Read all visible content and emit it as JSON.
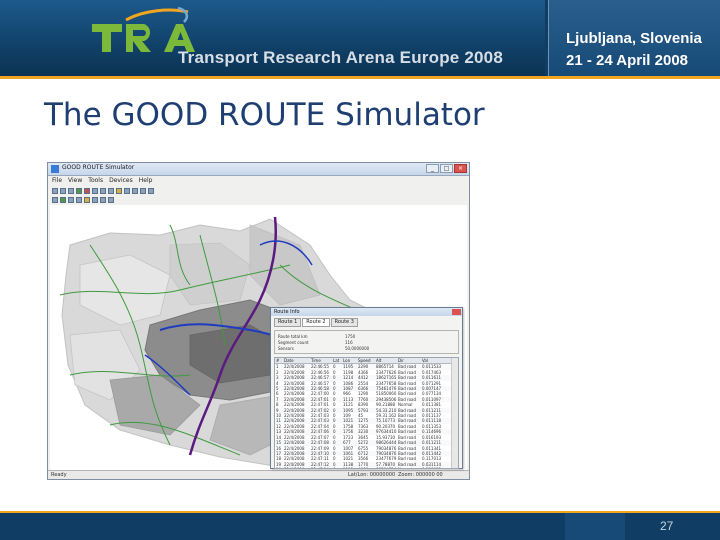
{
  "banner": {
    "logo_text": "TRA",
    "subtitle": "Transport Research Arena Europe 2008",
    "city": "Ljubljana, Slovenia",
    "dates": "21 - 24 April 2008",
    "colors": {
      "background": "#0f3d63",
      "accent": "#f2a51f",
      "logo_green": "#7cb83a"
    }
  },
  "slide": {
    "title": "The GOOD ROUTE Simulator",
    "page_number": "27"
  },
  "app_window": {
    "title": "GOOD ROUTE Simulator",
    "menu": [
      "File",
      "View",
      "Tools",
      "Devices",
      "Help"
    ],
    "window_buttons": [
      "minimize-icon",
      "maximize-icon",
      "close-icon"
    ],
    "status": {
      "left": "Ready",
      "middle": "Lat/Lon: 00000000",
      "right": "Zoom: 000000 00"
    }
  },
  "route_dialog": {
    "title": "Route Info",
    "tabs": [
      "Route 1",
      "Route 2",
      "Route 3"
    ],
    "info": [
      {
        "key": "Route total km",
        "value": "1750"
      },
      {
        "key": "Segment count",
        "value": "116"
      },
      {
        "key": "Sensors",
        "value": "50,0000000"
      }
    ],
    "columns": [
      "#",
      "Date",
      "Time",
      "Lat",
      "Lon",
      "Speed",
      "Alt",
      "Dir",
      "Val"
    ],
    "rows": [
      [
        "1",
        "22/4/2008",
        "22:46:55",
        "0",
        "1195",
        "2290",
        "8865714",
        "Bad road",
        "0.011533"
      ],
      [
        "2",
        "22/4/2008",
        "22:46:56",
        "0",
        "1198",
        "4366",
        "23477626",
        "Bad road",
        "0.017463"
      ],
      [
        "3",
        "22/4/2008",
        "22:46:57",
        "0",
        "1214",
        "4412",
        "18627165",
        "Bad road",
        "0.011611"
      ],
      [
        "4",
        "22/4/2008",
        "22:46:57",
        "0",
        "1086",
        "2554",
        "23477658",
        "Bad road",
        "0.071291"
      ],
      [
        "5",
        "22/4/2008",
        "22:46:58",
        "0",
        "1087",
        "6366",
        "75461476",
        "Bad road",
        "0.007147"
      ],
      [
        "6",
        "22/4/2008",
        "22:47:00",
        "0",
        "966",
        "1290",
        "51850060",
        "Bad road",
        "0.077134"
      ],
      [
        "7",
        "22/4/2008",
        "22:47:01",
        "0",
        "1113",
        "7760",
        "29438506",
        "Bad road",
        "0.011097"
      ],
      [
        "8",
        "22/4/2008",
        "22:47:01",
        "0",
        "1121",
        "8390",
        "90.21888",
        "Normal",
        "0.011381"
      ],
      [
        "9",
        "22/4/2008",
        "22:47:02",
        "0",
        "1095",
        "5793",
        "54.33.210",
        "Bad road",
        "0.011211"
      ],
      [
        "10",
        "22/4/2008",
        "22:47:03",
        "0",
        "109",
        "45",
        "59.31.162",
        "Bad road",
        "0.011137"
      ],
      [
        "11",
        "22/4/2008",
        "22:47:03",
        "0",
        "1021",
        "1275",
        "75.10773",
        "Bad road",
        "0.011118"
      ],
      [
        "12",
        "22/4/2008",
        "22:47:04",
        "0",
        "1758",
        "7363",
        "90.20370",
        "Bad road",
        "0.011353"
      ],
      [
        "13",
        "22/4/2008",
        "22:47:06",
        "0",
        "1756",
        "3230",
        "97634410",
        "Bad road",
        "0.114696"
      ],
      [
        "14",
        "22/4/2008",
        "22:47:07",
        "0",
        "1723",
        "3645",
        "15.93730",
        "Bad road",
        "0.016193"
      ],
      [
        "15",
        "22/4/2008",
        "22:47:08",
        "0",
        "677",
        "5272",
        "98626444",
        "Bad road",
        "0.011211"
      ],
      [
        "16",
        "22/4/2008",
        "22:47:09",
        "0",
        "1007",
        "6755",
        "79034876",
        "Bad road",
        "0.011341"
      ],
      [
        "17",
        "22/4/2008",
        "22:47:10",
        "0",
        "1061",
        "6712",
        "79034876",
        "Bad road",
        "0.011442"
      ],
      [
        "18",
        "22/4/2008",
        "22:47:11",
        "0",
        "1021",
        "3566",
        "23477679",
        "Bad road",
        "0.117013"
      ],
      [
        "19",
        "22/4/2008",
        "22:47:12",
        "0",
        "1138",
        "1770",
        "57.78870",
        "Bad road",
        "0.031114"
      ],
      [
        "20",
        "22/4/2008",
        "22:47:14",
        "0",
        "1113",
        "4666",
        "86504714",
        "Normal",
        "0.186693"
      ]
    ]
  }
}
